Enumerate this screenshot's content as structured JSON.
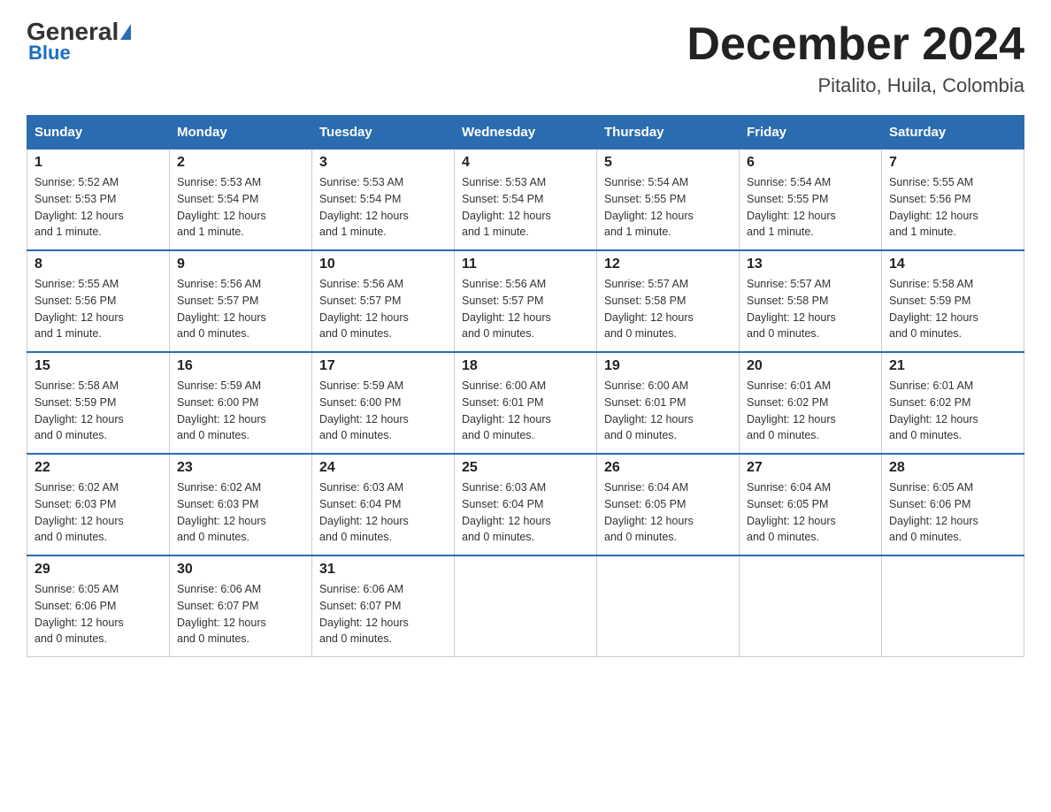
{
  "header": {
    "logo_general": "General",
    "logo_blue": "Blue",
    "month_title": "December 2024",
    "location": "Pitalito, Huila, Colombia"
  },
  "days_of_week": [
    "Sunday",
    "Monday",
    "Tuesday",
    "Wednesday",
    "Thursday",
    "Friday",
    "Saturday"
  ],
  "weeks": [
    [
      {
        "day": "1",
        "sunrise": "5:52 AM",
        "sunset": "5:53 PM",
        "daylight": "12 hours and 1 minute."
      },
      {
        "day": "2",
        "sunrise": "5:53 AM",
        "sunset": "5:54 PM",
        "daylight": "12 hours and 1 minute."
      },
      {
        "day": "3",
        "sunrise": "5:53 AM",
        "sunset": "5:54 PM",
        "daylight": "12 hours and 1 minute."
      },
      {
        "day": "4",
        "sunrise": "5:53 AM",
        "sunset": "5:54 PM",
        "daylight": "12 hours and 1 minute."
      },
      {
        "day": "5",
        "sunrise": "5:54 AM",
        "sunset": "5:55 PM",
        "daylight": "12 hours and 1 minute."
      },
      {
        "day": "6",
        "sunrise": "5:54 AM",
        "sunset": "5:55 PM",
        "daylight": "12 hours and 1 minute."
      },
      {
        "day": "7",
        "sunrise": "5:55 AM",
        "sunset": "5:56 PM",
        "daylight": "12 hours and 1 minute."
      }
    ],
    [
      {
        "day": "8",
        "sunrise": "5:55 AM",
        "sunset": "5:56 PM",
        "daylight": "12 hours and 1 minute."
      },
      {
        "day": "9",
        "sunrise": "5:56 AM",
        "sunset": "5:57 PM",
        "daylight": "12 hours and 0 minutes."
      },
      {
        "day": "10",
        "sunrise": "5:56 AM",
        "sunset": "5:57 PM",
        "daylight": "12 hours and 0 minutes."
      },
      {
        "day": "11",
        "sunrise": "5:56 AM",
        "sunset": "5:57 PM",
        "daylight": "12 hours and 0 minutes."
      },
      {
        "day": "12",
        "sunrise": "5:57 AM",
        "sunset": "5:58 PM",
        "daylight": "12 hours and 0 minutes."
      },
      {
        "day": "13",
        "sunrise": "5:57 AM",
        "sunset": "5:58 PM",
        "daylight": "12 hours and 0 minutes."
      },
      {
        "day": "14",
        "sunrise": "5:58 AM",
        "sunset": "5:59 PM",
        "daylight": "12 hours and 0 minutes."
      }
    ],
    [
      {
        "day": "15",
        "sunrise": "5:58 AM",
        "sunset": "5:59 PM",
        "daylight": "12 hours and 0 minutes."
      },
      {
        "day": "16",
        "sunrise": "5:59 AM",
        "sunset": "6:00 PM",
        "daylight": "12 hours and 0 minutes."
      },
      {
        "day": "17",
        "sunrise": "5:59 AM",
        "sunset": "6:00 PM",
        "daylight": "12 hours and 0 minutes."
      },
      {
        "day": "18",
        "sunrise": "6:00 AM",
        "sunset": "6:01 PM",
        "daylight": "12 hours and 0 minutes."
      },
      {
        "day": "19",
        "sunrise": "6:00 AM",
        "sunset": "6:01 PM",
        "daylight": "12 hours and 0 minutes."
      },
      {
        "day": "20",
        "sunrise": "6:01 AM",
        "sunset": "6:02 PM",
        "daylight": "12 hours and 0 minutes."
      },
      {
        "day": "21",
        "sunrise": "6:01 AM",
        "sunset": "6:02 PM",
        "daylight": "12 hours and 0 minutes."
      }
    ],
    [
      {
        "day": "22",
        "sunrise": "6:02 AM",
        "sunset": "6:03 PM",
        "daylight": "12 hours and 0 minutes."
      },
      {
        "day": "23",
        "sunrise": "6:02 AM",
        "sunset": "6:03 PM",
        "daylight": "12 hours and 0 minutes."
      },
      {
        "day": "24",
        "sunrise": "6:03 AM",
        "sunset": "6:04 PM",
        "daylight": "12 hours and 0 minutes."
      },
      {
        "day": "25",
        "sunrise": "6:03 AM",
        "sunset": "6:04 PM",
        "daylight": "12 hours and 0 minutes."
      },
      {
        "day": "26",
        "sunrise": "6:04 AM",
        "sunset": "6:05 PM",
        "daylight": "12 hours and 0 minutes."
      },
      {
        "day": "27",
        "sunrise": "6:04 AM",
        "sunset": "6:05 PM",
        "daylight": "12 hours and 0 minutes."
      },
      {
        "day": "28",
        "sunrise": "6:05 AM",
        "sunset": "6:06 PM",
        "daylight": "12 hours and 0 minutes."
      }
    ],
    [
      {
        "day": "29",
        "sunrise": "6:05 AM",
        "sunset": "6:06 PM",
        "daylight": "12 hours and 0 minutes."
      },
      {
        "day": "30",
        "sunrise": "6:06 AM",
        "sunset": "6:07 PM",
        "daylight": "12 hours and 0 minutes."
      },
      {
        "day": "31",
        "sunrise": "6:06 AM",
        "sunset": "6:07 PM",
        "daylight": "12 hours and 0 minutes."
      },
      null,
      null,
      null,
      null
    ]
  ],
  "labels": {
    "sunrise_prefix": "Sunrise: ",
    "sunset_prefix": "Sunset: ",
    "daylight_prefix": "Daylight: "
  }
}
